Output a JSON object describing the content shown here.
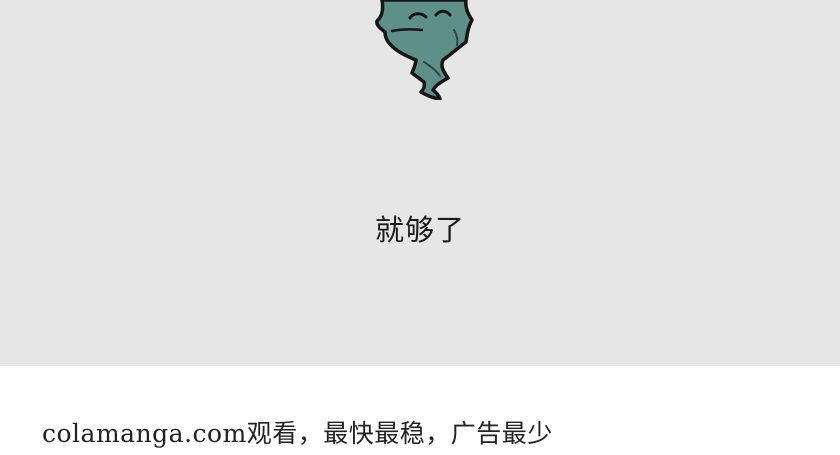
{
  "panel": {
    "background": "#e6e6e6",
    "dialogue_text": "就够了",
    "character": "ghost-character-illustration",
    "character_color": "#5f8f89"
  },
  "footer": {
    "promo_text": "colamanga.com观看，最快最稳，广告最少"
  }
}
